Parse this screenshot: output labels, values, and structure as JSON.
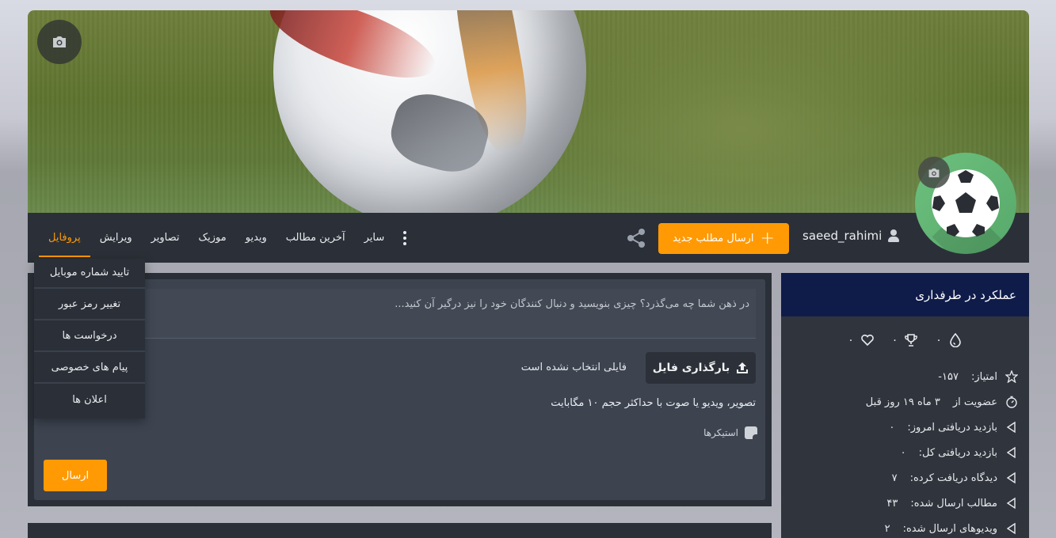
{
  "profile": {
    "username": "saeed_rahimi",
    "new_post_label": "ارسال مطلب جدید"
  },
  "nav": {
    "tabs": [
      {
        "label": "پروفایل",
        "active": true
      },
      {
        "label": "ویرایش",
        "active": false
      },
      {
        "label": "تصاویر",
        "active": false
      },
      {
        "label": "موزیک",
        "active": false
      },
      {
        "label": "ویدیو",
        "active": false
      },
      {
        "label": "آخرین مطالب",
        "active": false
      },
      {
        "label": "سایر",
        "active": false
      }
    ]
  },
  "dropdown": {
    "items": [
      "تایید شماره موبایل",
      "تغییر رمز عبور",
      "درخواست ها",
      "پیام های خصوصی",
      "اعلان ها"
    ]
  },
  "composer": {
    "placeholder": "در ذهن شما چه می‌گذرد؟ چیزی بنویسید و دنبال کنندگان خود را نیز درگیر آن کنید...",
    "upload_label": "بارگذاری فایل",
    "no_file_text": "فایلی انتخاب نشده است",
    "upload_hint": "تصویر، ویدیو یا صوت با حداکثر حجم ۱۰ مگابایت",
    "stickers_label": "استیکرها",
    "send_label": "ارسال"
  },
  "sidebar": {
    "title": "عملکرد در طرفداری",
    "stats": {
      "drop": "۰",
      "trophy": "۰",
      "heart": "۰"
    },
    "info": [
      {
        "label": "امتیاز:",
        "value": "۱۵۷-"
      },
      {
        "label": "عضویت از",
        "value": "۳ ماه ۱۹ روز قبل"
      },
      {
        "label": "بازدید دریافتی امروز:",
        "value": "۰"
      },
      {
        "label": "بازدید دریافتی کل:",
        "value": "۰"
      },
      {
        "label": "دیدگاه دریافت کرده:",
        "value": "۷"
      },
      {
        "label": "مطالب ارسال شده:",
        "value": "۴۳"
      },
      {
        "label": "ویدیوهای ارسال شده:",
        "value": "۲"
      }
    ]
  },
  "colors": {
    "accent": "#ff9a05",
    "sidebar_header": "#0f1c4a",
    "panel": "#2b3038"
  }
}
